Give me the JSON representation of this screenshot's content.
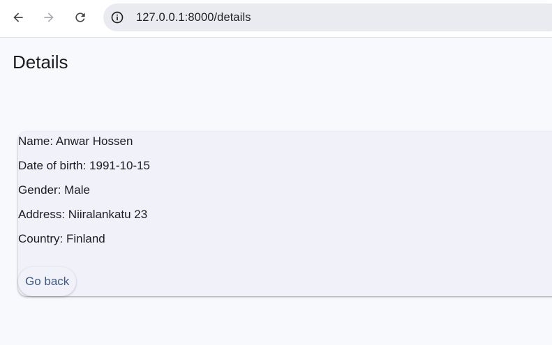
{
  "browser": {
    "url": "127.0.0.1:8000/details",
    "icons": {
      "back": "arrow-left-icon",
      "forward": "arrow-right-icon",
      "reload": "reload-icon",
      "info": "info-icon"
    }
  },
  "page": {
    "title": "Details"
  },
  "details": {
    "name": "Name: Anwar Hossen",
    "dob": "Date of birth: 1991-10-15",
    "gender": "Gender: Male",
    "address": "Address: Niiralankatu 23",
    "country": "Country: Finland"
  },
  "actions": {
    "go_back_label": "Go back"
  },
  "colors": {
    "background": "#f8f9fd",
    "card": "#f0f1f9",
    "link": "#3c5a85",
    "omnibox": "#e9ebf0"
  }
}
